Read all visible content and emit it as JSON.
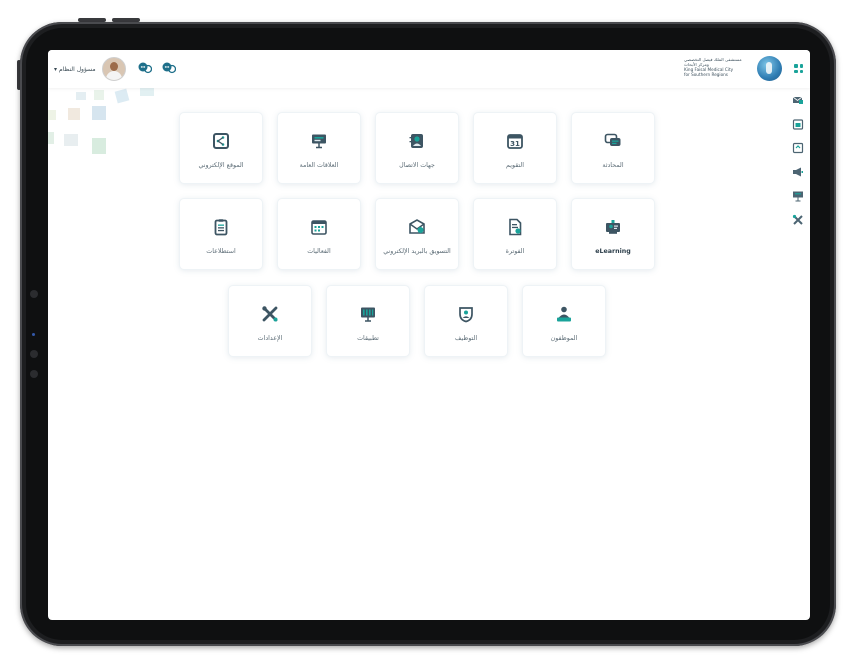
{
  "topbar": {
    "user_name": "مسؤول النظام",
    "logo_lines": [
      "مستشفى الملك فيصل التخصصي",
      "ومركز الأبحاث",
      "King Faisal Medical City",
      "for Southern Regions"
    ]
  },
  "tiles": [
    {
      "name": "tile-chat",
      "label": "المحادثة",
      "icon": "chat-bubbles-icon",
      "row": 0,
      "col": 4
    },
    {
      "name": "tile-calendar",
      "label": "التقويم",
      "icon": "calendar-icon",
      "row": 0,
      "col": 3
    },
    {
      "name": "tile-contacts",
      "label": "جهات الاتصال",
      "icon": "contacts-icon",
      "row": 0,
      "col": 2
    },
    {
      "name": "tile-public-relations",
      "label": "العلاقات العامة",
      "icon": "presentation-board-icon",
      "row": 0,
      "col": 1
    },
    {
      "name": "tile-website",
      "label": "الموقع الإلكتروني",
      "icon": "share-screen-icon",
      "row": 0,
      "col": 0
    },
    {
      "name": "tile-elearning",
      "label": "eLearning",
      "icon": "elearning-icon",
      "row": 1,
      "col": 4
    },
    {
      "name": "tile-invoice",
      "label": "الفوترة",
      "icon": "invoice-icon",
      "row": 1,
      "col": 3
    },
    {
      "name": "tile-email-marketing",
      "label": "التسويق بالبريد الإلكتروني",
      "icon": "email-marketing-icon",
      "row": 1,
      "col": 2
    },
    {
      "name": "tile-events",
      "label": "الفعاليات",
      "icon": "events-calendar-icon",
      "row": 1,
      "col": 1
    },
    {
      "name": "tile-surveys",
      "label": "استطلاعات",
      "icon": "clipboard-icon",
      "row": 1,
      "col": 0
    },
    {
      "name": "tile-employees",
      "label": "الموظفون",
      "icon": "employees-icon",
      "row": 2,
      "col": 3
    },
    {
      "name": "tile-recruitment",
      "label": "التوظيف",
      "icon": "recruitment-icon",
      "row": 2,
      "col": 2
    },
    {
      "name": "tile-apps",
      "label": "تطبيقات",
      "icon": "apps-monitor-icon",
      "row": 2,
      "col": 1
    },
    {
      "name": "tile-settings",
      "label": "الإعدادات",
      "icon": "tools-icon",
      "row": 2,
      "col": 0
    }
  ],
  "side_rail": [
    "mail-icon",
    "calendar-small-icon",
    "document-icon",
    "megaphone-icon",
    "presentation-icon",
    "tools-small-icon"
  ],
  "colors": {
    "accent": "#1aa39a",
    "icon_dark": "#3d5563",
    "text": "#5b6b75",
    "tile_border": "#eef3f6"
  }
}
